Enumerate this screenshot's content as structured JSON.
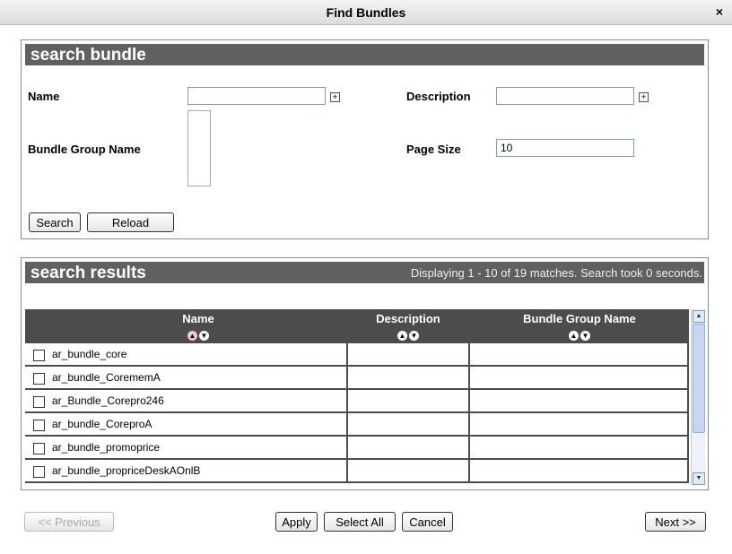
{
  "dialog": {
    "title": "Find Bundles",
    "close_glyph": "×"
  },
  "search": {
    "heading": "search bundle",
    "name_label": "Name",
    "name_value": "",
    "description_label": "Description",
    "description_value": "",
    "bundle_group_label": "Bundle Group Name",
    "page_size_label": "Page Size",
    "page_size_value": "10",
    "search_button": "Search",
    "reload_button": "Reload"
  },
  "results": {
    "heading": "search results",
    "info": "Displaying 1 - 10 of 19 matches. Search took 0 seconds.",
    "columns": [
      "Name",
      "Description",
      "Bundle Group Name"
    ],
    "rows": [
      {
        "name": "ar_bundle_core",
        "description": "",
        "group": ""
      },
      {
        "name": "ar_bundle_CorememA",
        "description": "",
        "group": ""
      },
      {
        "name": "ar_Bundle_Corepro246",
        "description": "",
        "group": ""
      },
      {
        "name": "ar_bundle_CoreproA",
        "description": "",
        "group": ""
      },
      {
        "name": "ar_bundle_promoprice",
        "description": "",
        "group": ""
      },
      {
        "name": "ar_bundle_propriceDeskAOnlB",
        "description": "",
        "group": ""
      }
    ]
  },
  "footer": {
    "previous": "<< Previous",
    "apply": "Apply",
    "select_all": "Select All",
    "cancel": "Cancel",
    "next": "Next >>"
  }
}
